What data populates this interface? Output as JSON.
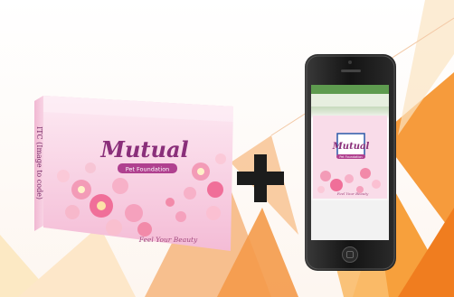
{
  "product_box": {
    "brand": "Mutual",
    "subtitle": "Pet Foundation",
    "tagline": "Feel Your Beauty",
    "side_text": "ITC (Image to code)"
  },
  "phone_screen": {
    "brand": "Mutual",
    "subtitle": "Pet Foundation",
    "tagline": "Feel Your Beauty"
  },
  "symbols": {
    "plus": "+"
  },
  "colors": {
    "background": "#ffffff",
    "box_pink": "#f7c8dd",
    "box_pink_light": "#fbe3ee",
    "brand_purple": "#8a2f7a",
    "label_purple": "#b0408f",
    "orange_1": "#f48a2a",
    "orange_2": "#f9b24a",
    "phone_body": "#1e1e1e"
  }
}
